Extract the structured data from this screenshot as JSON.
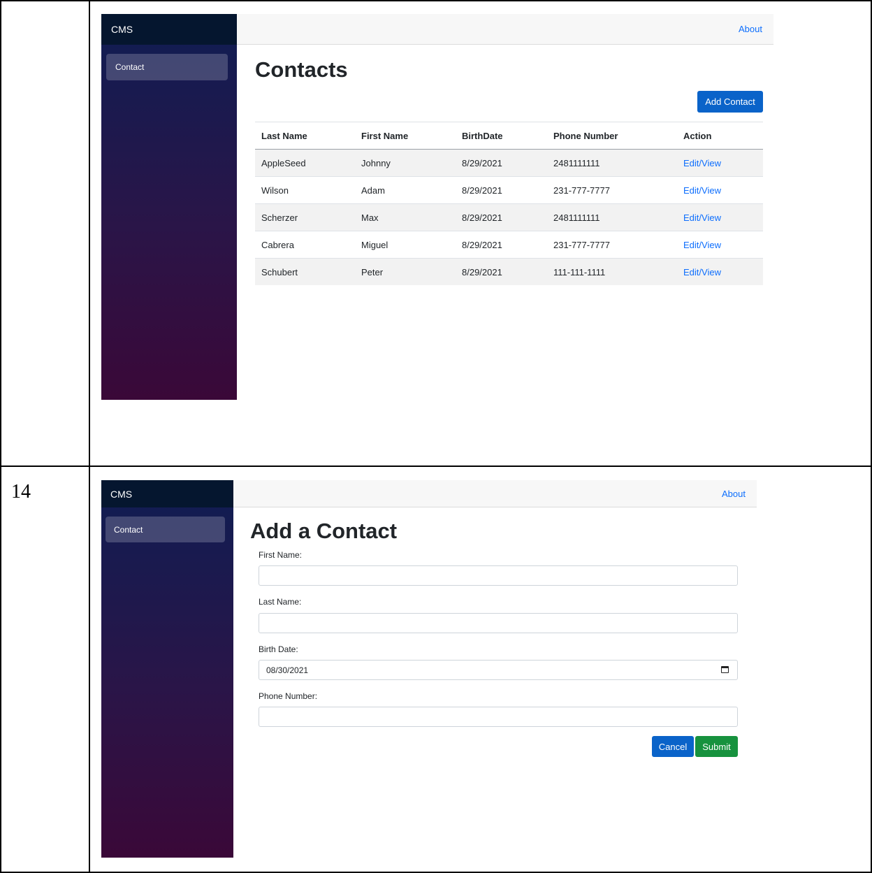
{
  "document": {
    "row_number": "14"
  },
  "contacts_screen": {
    "brand": "CMS",
    "sidebar_item": "Contact",
    "nav_about": "About",
    "title": "Contacts",
    "add_button": "Add Contact",
    "columns": [
      "Last Name",
      "First Name",
      "BirthDate",
      "Phone Number",
      "Action"
    ],
    "rows": [
      {
        "last": "AppleSeed",
        "first": "Johnny",
        "birth": "8/29/2021",
        "phone": "2481111111",
        "action": "Edit/View"
      },
      {
        "last": "Wilson",
        "first": "Adam",
        "birth": "8/29/2021",
        "phone": "231-777-7777",
        "action": "Edit/View"
      },
      {
        "last": "Scherzer",
        "first": "Max",
        "birth": "8/29/2021",
        "phone": "2481111111",
        "action": "Edit/View"
      },
      {
        "last": "Cabrera",
        "first": "Miguel",
        "birth": "8/29/2021",
        "phone": "231-777-7777",
        "action": "Edit/View"
      },
      {
        "last": "Schubert",
        "first": "Peter",
        "birth": "8/29/2021",
        "phone": "111-111-1111",
        "action": "Edit/View"
      }
    ]
  },
  "add_screen": {
    "brand": "CMS",
    "sidebar_item": "Contact",
    "nav_about": "About",
    "title": "Add a Contact",
    "fields": {
      "first_name": {
        "label": "First Name:",
        "value": ""
      },
      "last_name": {
        "label": "Last Name:",
        "value": ""
      },
      "birth_date": {
        "label": "Birth Date:",
        "value": "08/30/2021"
      },
      "phone": {
        "label": "Phone Number:",
        "value": ""
      }
    },
    "cancel": "Cancel",
    "submit": "Submit"
  },
  "colors": {
    "primary": "#0a63c9",
    "success": "#17923e",
    "link": "#0d6efd",
    "brand_bar": "#05162f"
  },
  "icons": [
    "calendar-icon"
  ]
}
